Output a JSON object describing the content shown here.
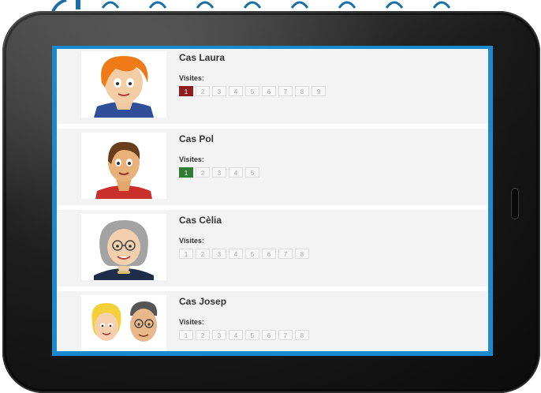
{
  "cases": [
    {
      "title": "Cas Laura",
      "visits_label": "Visites:",
      "visits": [
        "1",
        "2",
        "3",
        "4",
        "5",
        "6",
        "7",
        "8",
        "9"
      ],
      "active_visit": "1",
      "active_color": "#8e1e1e"
    },
    {
      "title": "Cas Pol",
      "visits_label": "Visites:",
      "visits": [
        "1",
        "2",
        "3",
        "4",
        "5"
      ],
      "active_visit": "1",
      "active_color": "#2f7a34"
    },
    {
      "title": "Cas Cèlia",
      "visits_label": "Visites:",
      "visits": [
        "1",
        "2",
        "3",
        "4",
        "5",
        "6",
        "7",
        "8"
      ],
      "active_visit": null
    },
    {
      "title": "Cas Josep",
      "visits_label": "Visites:",
      "visits": [
        "1",
        "2",
        "3",
        "4",
        "5",
        "6",
        "7",
        "8"
      ],
      "active_visit": null
    }
  ],
  "colors": {
    "screen_border": "#1a8ad0",
    "case_bg": "#f3f3f3",
    "visit_red": "#8e1e1e",
    "visit_green": "#2f7a34"
  },
  "icons": {
    "laura": "cartoon-woman-orange-hair-avatar",
    "pol": "cartoon-young-man-avatar",
    "celia": "cartoon-elderly-woman-avatar",
    "josep": "cartoon-elderly-couple-avatar"
  }
}
